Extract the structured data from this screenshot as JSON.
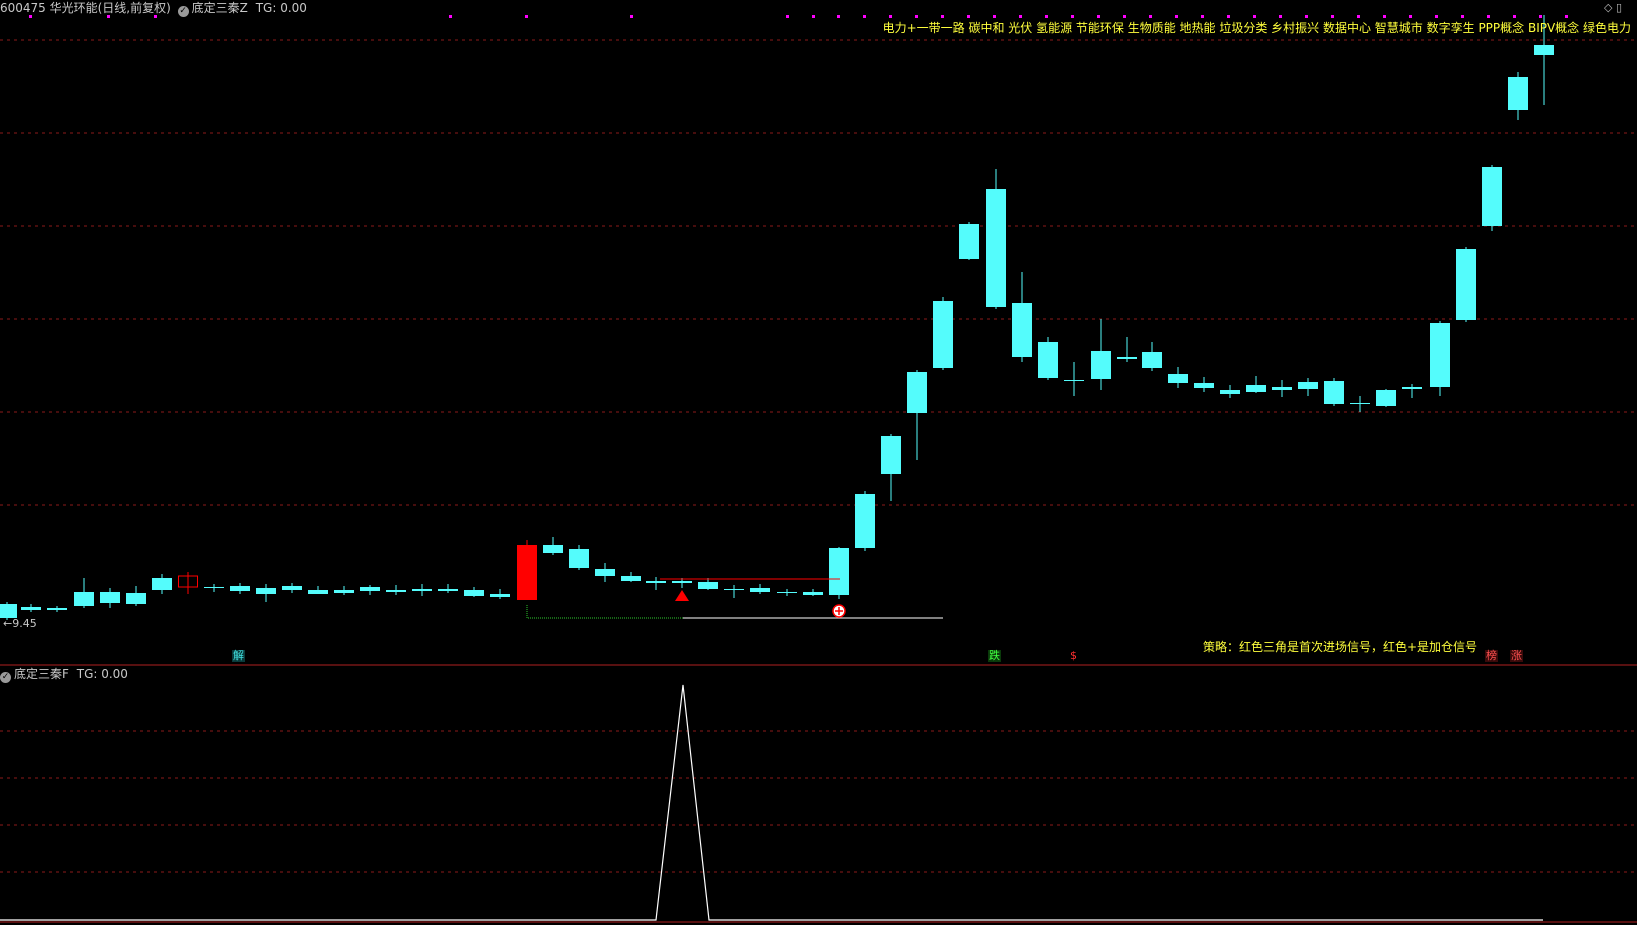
{
  "header": {
    "stock": "600475 华光环能(日线,前复权)",
    "indicator_main": "底定三秦Z",
    "tg_main": "TG: 0.00"
  },
  "concepts": "电力+一带一路 碳中和 光伏 氢能源 节能环保 生物质能 地热能 垃圾分类 乡村振兴 数据中心 智慧城市 数字孪生 PPP概念 BIPV概念 绿色电力",
  "price_label": "←9.45",
  "strategy_text": "策略：红色三角是首次进场信号，红色+是加仓信号",
  "event_tags": [
    {
      "text": "解",
      "color": "#40e0e0",
      "bg": "#0a3a3a"
    },
    {
      "text": "跌",
      "color": "#40ff40",
      "bg": "#0a3a0a"
    },
    {
      "text": "$",
      "color": "#ff3030",
      "bg": "#000000"
    },
    {
      "text": "榜",
      "color": "#ff5050",
      "bg": "#3a0a0a"
    },
    {
      "text": "涨",
      "color": "#ff5050",
      "bg": "#3a0a0a"
    }
  ],
  "sub_panel": {
    "indicator": "底定三秦F",
    "tg": "TG: 0.00"
  },
  "colors": {
    "up": "#ff0000",
    "down": "#54fcfc",
    "grid": "#8b1a1a",
    "text_yellow": "#ffff3c",
    "marker": "#ff00ff"
  },
  "window_controls": [
    "◇",
    "▯"
  ],
  "signal_icons": [
    "triangle-up-icon",
    "circle-plus-icon"
  ]
}
